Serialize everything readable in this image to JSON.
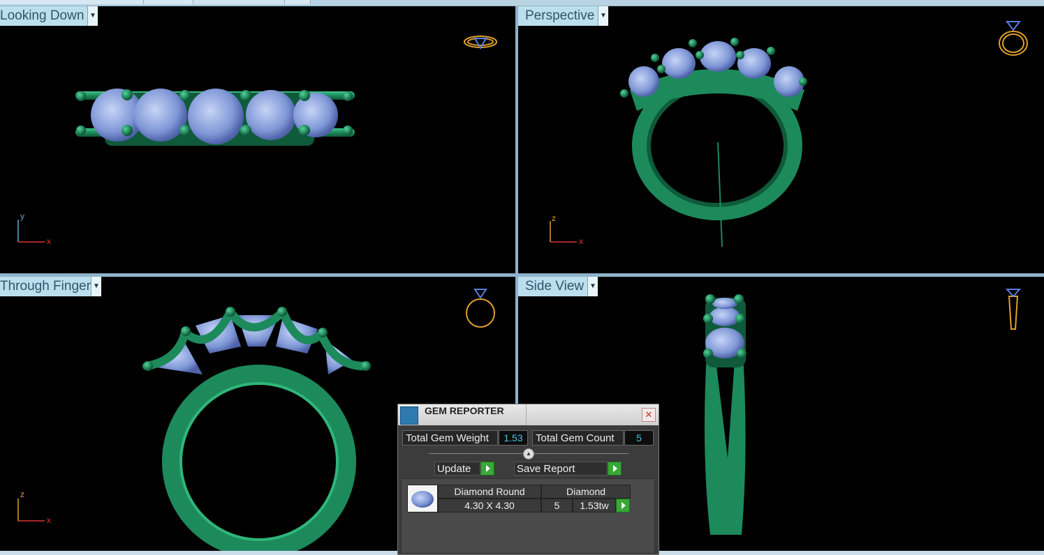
{
  "viewports": {
    "top_left": {
      "label": "Looking Down",
      "axes": {
        "v": "y",
        "h": "x"
      }
    },
    "top_right": {
      "label": "Perspective",
      "axes": {
        "v": "z",
        "h": "x"
      }
    },
    "bottom_left": {
      "label": "Through Finger",
      "axes": {
        "v": "z",
        "h": "x"
      }
    },
    "bottom_right": {
      "label": "Side View"
    }
  },
  "gem_reporter": {
    "title": "GEM REPORTER",
    "total_weight_label": "Total Gem Weight",
    "total_weight_value": "1.53",
    "total_count_label": "Total Gem Count",
    "total_count_value": "5",
    "update_label": "Update",
    "save_report_label": "Save Report",
    "row": {
      "shape": "Diamond Round",
      "material": "Diamond",
      "size": "4.30 X 4.30",
      "count": "5",
      "weight": "1.53tw"
    }
  },
  "colors": {
    "metal": "#1f8a5c",
    "gem": "#8fa6e0",
    "wireframe": "#e0a12a",
    "label_bg": "#bcdfee"
  },
  "icons": [
    "dropdown-arrow-icon",
    "ring-preview-icon",
    "close-icon",
    "go-arrow-icon",
    "gem-thumbnail-icon"
  ]
}
